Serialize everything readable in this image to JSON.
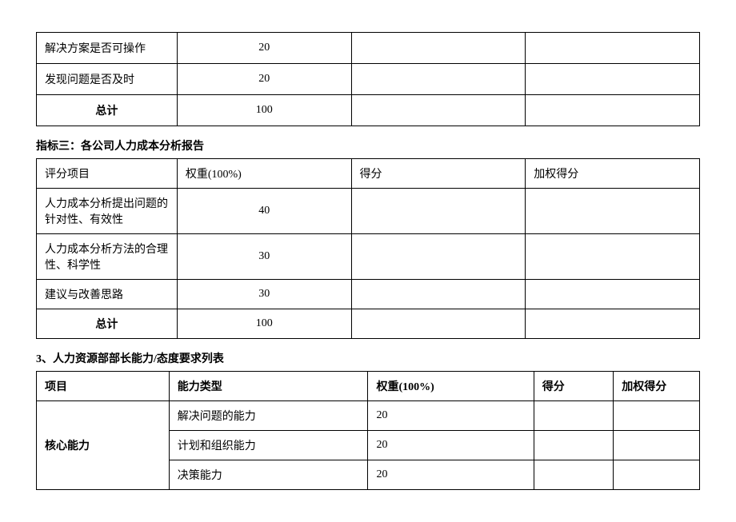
{
  "table1": {
    "rows": [
      {
        "item": "解决方案是否可操作",
        "weight": "20",
        "score": "",
        "weighted": ""
      },
      {
        "item": "发现问题是否及时",
        "weight": "20",
        "score": "",
        "weighted": ""
      },
      {
        "item": "总计",
        "weight": "100",
        "score": "",
        "weighted": ""
      }
    ]
  },
  "section2": {
    "heading": "指标三：各公司人力成本分析报告"
  },
  "table2": {
    "headers": {
      "col0": "评分项目",
      "col1": "权重(100%)",
      "col2": "得分",
      "col3": "加权得分"
    },
    "rows": [
      {
        "item": "人力成本分析提出问题的针对性、有效性",
        "weight": "40",
        "score": "",
        "weighted": ""
      },
      {
        "item": "人力成本分析方法的合理性、科学性",
        "weight": "30",
        "score": "",
        "weighted": ""
      },
      {
        "item": "建议与改善思路",
        "weight": "30",
        "score": "",
        "weighted": ""
      },
      {
        "item": "总计",
        "weight": "100",
        "score": "",
        "weighted": ""
      }
    ]
  },
  "section3": {
    "heading": "3、人力资源部部长能力/态度要求列表"
  },
  "table3": {
    "headers": {
      "col0": "项目",
      "col1": "能力类型",
      "col2": "权重(100%)",
      "col3": "得分",
      "col4": "加权得分"
    },
    "group_label": "核心能力",
    "rows": [
      {
        "type": "解决问题的能力",
        "weight": "20",
        "score": "",
        "weighted": ""
      },
      {
        "type": "计划和组织能力",
        "weight": "20",
        "score": "",
        "weighted": ""
      },
      {
        "type": "决策能力",
        "weight": "20",
        "score": "",
        "weighted": ""
      }
    ]
  }
}
